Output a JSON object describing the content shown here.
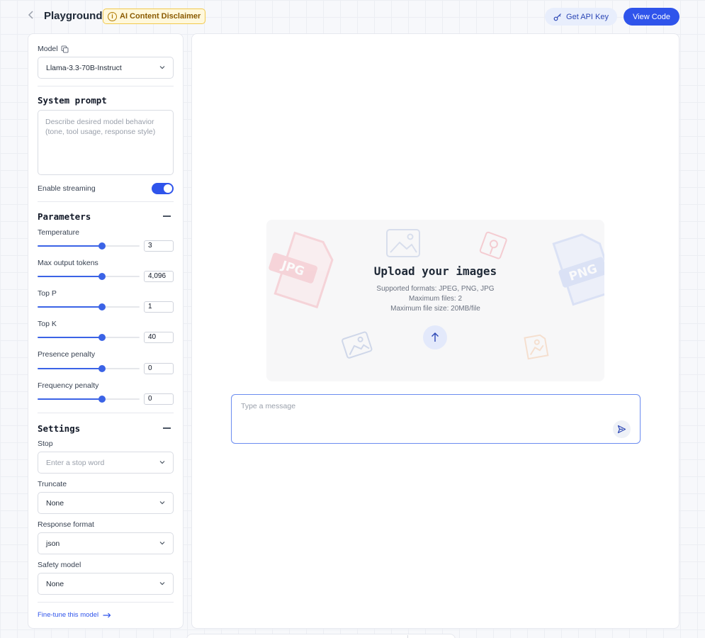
{
  "header": {
    "title": "Playground",
    "disclaimer": "AI Content Disclaimer",
    "api_key_label": "Get API Key",
    "view_code_label": "View Code"
  },
  "sidebar": {
    "model_label": "Model",
    "model_value": "Llama-3.3-70B-Instruct",
    "system_prompt_title": "System prompt",
    "system_prompt_placeholder": "Describe desired model behavior (tone, tool usage, response style)",
    "streaming_label": "Enable streaming",
    "streaming_enabled": true,
    "parameters_title": "Parameters",
    "parameters": [
      {
        "label": "Temperature",
        "value": "3",
        "fraction": 0.63
      },
      {
        "label": "Max output tokens",
        "value": "4,096",
        "fraction": 0.63
      },
      {
        "label": "Top P",
        "value": "1",
        "fraction": 0.63
      },
      {
        "label": "Top K",
        "value": "40",
        "fraction": 0.63
      },
      {
        "label": "Presence penalty",
        "value": "0",
        "fraction": 0.63
      },
      {
        "label": "Frequency penalty",
        "value": "0",
        "fraction": 0.63
      }
    ],
    "settings_title": "Settings",
    "stop_label": "Stop",
    "stop_placeholder": "Enter a stop word",
    "truncate_label": "Truncate",
    "truncate_value": "None",
    "response_format_label": "Response format",
    "response_format_value": "json",
    "safety_model_label": "Safety model",
    "safety_model_value": "None",
    "fine_tune_link": "Fine-tune this model"
  },
  "main": {
    "upload_title": "Upload your images",
    "upload_formats": "Supported formats: JPEG, PNG, JPG",
    "upload_max_files": "Maximum files: 2",
    "upload_max_size": "Maximum file size: 20MB/file",
    "message_placeholder": "Type a message"
  },
  "colors": {
    "accent": "#2f54eb",
    "disclaimer_bg": "#fff8dc",
    "disclaimer_border": "#f2c94c"
  }
}
